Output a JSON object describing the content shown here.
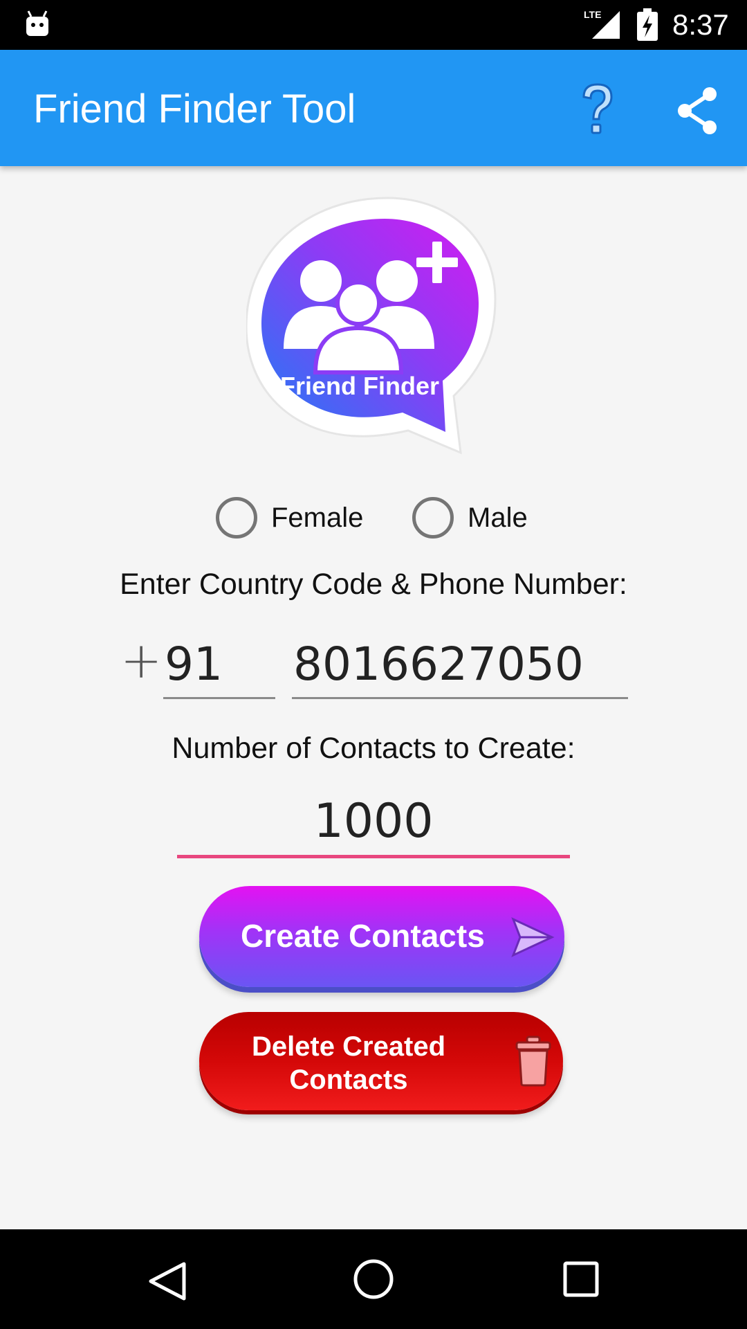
{
  "status_bar": {
    "network": "LTE",
    "time": "8:37"
  },
  "app_bar": {
    "title": "Friend Finder Tool",
    "icons": [
      "help-icon",
      "share-icon"
    ]
  },
  "logo": {
    "text": "Friend Finder"
  },
  "gender": {
    "options": [
      "Female",
      "Male"
    ],
    "selected": null
  },
  "phone": {
    "label": "Enter Country Code & Phone Number:",
    "prefix": "+",
    "country_code": "91",
    "number": "8016627050"
  },
  "contacts": {
    "label": "Number of Contacts to Create:",
    "count": "1000"
  },
  "buttons": {
    "create_label": "Create Contacts",
    "delete_label_line1": "Delete Created",
    "delete_label_line2": "Contacts"
  },
  "colors": {
    "app_bar": "#2196f3",
    "accent_underline": "#e8477f",
    "create_button": "#a133f7",
    "delete_button": "#d40808"
  }
}
